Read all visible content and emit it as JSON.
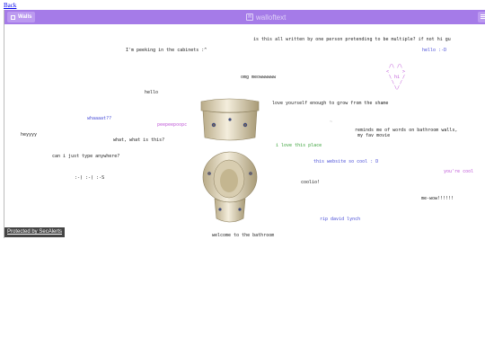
{
  "nav": {
    "back_label": "Back"
  },
  "header": {
    "walls_label": "Walls",
    "brand": "walloftext",
    "brand_logo_letter": "H"
  },
  "footer": {
    "protection_label": "Protected by SecAlerts"
  },
  "notes": [
    {
      "text": "is this all written by one person pretending to be multiple? if not hi gu",
      "color": "#222222"
    },
    {
      "text": "I'm peeking in the cabinets :^",
      "color": "#222222"
    },
    {
      "text": "hello :-D",
      "color": "#4a4fd8"
    },
    {
      "text": " /\\ /\\\n<     >\n \\ hi /\n  \\  /\n   \\/",
      "color": "#c05ad8"
    },
    {
      "text": "omg meowwwwww",
      "color": "#222222"
    },
    {
      "text": "hello",
      "color": "#222222"
    },
    {
      "text": "love yourself enough to grow from the shame",
      "color": "#222222"
    },
    {
      "text": "whaaaat??",
      "color": "#4a4fd8"
    },
    {
      "text": "peepeepoopc",
      "color": "#c05ad8"
    },
    {
      "text": "reminds me of words on bathroom walls,\n my fav movie",
      "color": "#222222"
    },
    {
      "text": "heyyyy",
      "color": "#222222"
    },
    {
      "text": "what, what is this?",
      "color": "#222222"
    },
    {
      "text": "i love this place",
      "color": "#3ba23b"
    },
    {
      "text": "can i just type anywhere?",
      "color": "#222222"
    },
    {
      "text": "this website so cool : D",
      "color": "#4a4fd8"
    },
    {
      "text": "you're cool",
      "color": "#c05ad8"
    },
    {
      "text": ":-) :-( :-S",
      "color": "#222222"
    },
    {
      "text": "coolio!",
      "color": "#222222"
    },
    {
      "text": "me-wow!!!!!!",
      "color": "#222222"
    },
    {
      "text": "rip david lynch",
      "color": "#4a4fd8"
    },
    {
      "text": "welcome to the bathroom",
      "color": "#222222"
    },
    {
      "text": "~",
      "color": "#bbbbbb"
    }
  ],
  "colors": {
    "topbar": "#a57be8",
    "button": "#bc9af0"
  },
  "icons": {
    "walls": "grid-icon",
    "brand": "logo-icon",
    "menu": "menu-icon",
    "toilet": "toilet-image"
  }
}
